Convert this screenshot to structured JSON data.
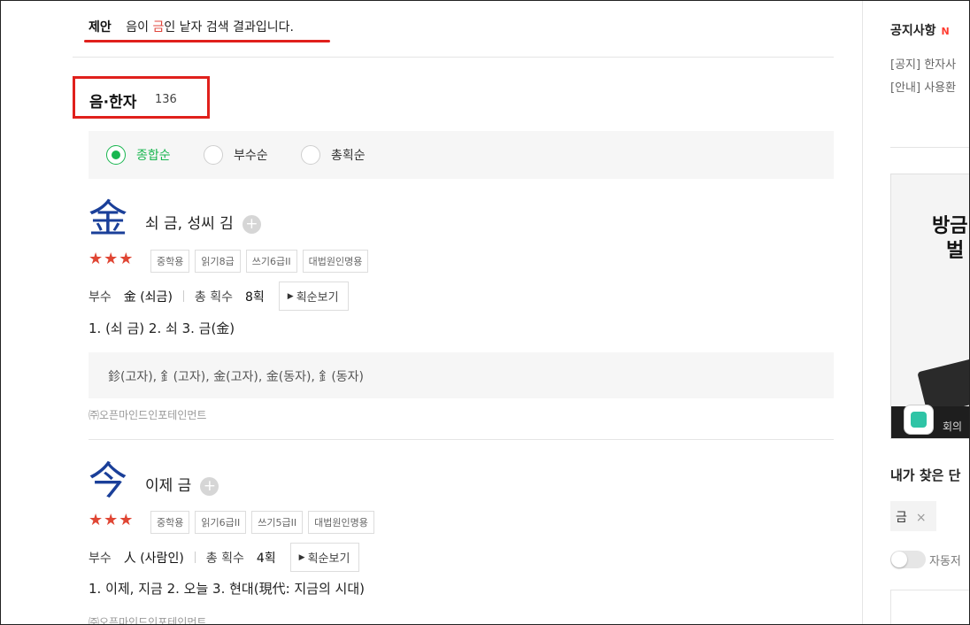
{
  "suggestion": {
    "tag": "제안",
    "prefix": "음이 ",
    "highlight": "금",
    "suffix": "인 낱자 검색 결과입니다."
  },
  "section": {
    "title": "음·한자",
    "count": "136"
  },
  "sort": {
    "options": [
      {
        "label": "종합순",
        "selected": true
      },
      {
        "label": "부수순",
        "selected": false
      },
      {
        "label": "총획순",
        "selected": false
      }
    ]
  },
  "entries": [
    {
      "hanja": "金",
      "meaning": "쇠 금, 성씨 김",
      "stars": "★★★",
      "badges": [
        "중학용",
        "읽기8급",
        "쓰기6급II",
        "대법원인명용"
      ],
      "radical_label": "부수",
      "radical_value": "金 (쇠금)",
      "strokes_label": "총 획수",
      "strokes_value": "8획",
      "stroke_button": "획순보기",
      "definitions": "1. (쇠 금)  2. 쇠  3. 금(金)",
      "variants": "鉁(고자), 釒(고자), 金(고자), 金(동자), 釒(동자)",
      "copyright": "㈜오픈마인드인포테인먼트"
    },
    {
      "hanja": "今",
      "meaning": "이제 금",
      "stars": "★★★",
      "badges": [
        "중학용",
        "읽기6급II",
        "쓰기5급II",
        "대법원인명용"
      ],
      "radical_label": "부수",
      "radical_value": "人 (사람인)",
      "strokes_label": "총 획수",
      "strokes_value": "4획",
      "stroke_button": "획순보기",
      "definitions": "1. 이제, 지금  2. 오늘  3. 현대(現代: 지금의 시대)",
      "copyright": "㈜오픈마인드인포테인먼트"
    }
  ],
  "sidebar": {
    "notice_title": "공지사항",
    "notice_badge": "N",
    "notices": [
      "[공지] 한자사",
      "[안내] 사용환"
    ],
    "ad_line1": "방금",
    "ad_line2": "벌",
    "ad_caption": "회의",
    "recent_title": "내가 찾은 단",
    "recent_chip": "금",
    "recent_chip_close": "×",
    "toggle_label": "자동저"
  }
}
